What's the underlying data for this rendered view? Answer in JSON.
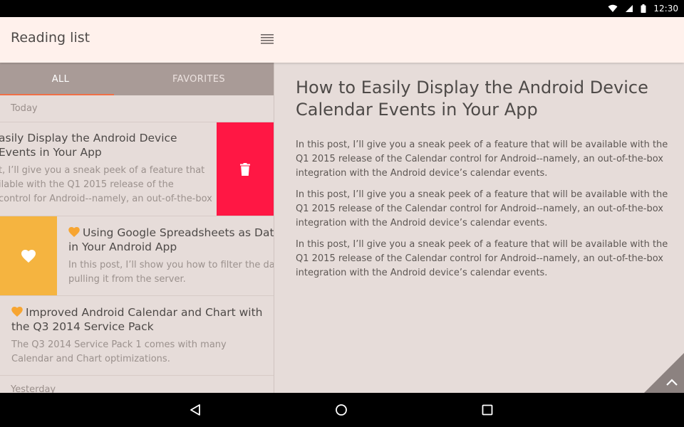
{
  "status_bar": {
    "time": "12:30",
    "icons": [
      "wifi-icon",
      "signal-icon",
      "battery-icon"
    ]
  },
  "app_bar": {
    "title": "Reading list",
    "menu_icon": "list-icon"
  },
  "tabs": [
    {
      "label": "ALL",
      "selected": true
    },
    {
      "label": "FAVORITES",
      "selected": false
    }
  ],
  "list": {
    "section_today": "Today",
    "section_yesterday": "Yesterday",
    "items": [
      {
        "title_line1": "asily Display the Android Device",
        "title_line2": " Events in Your App",
        "body_line1": "t, I’ll give you a sneak peek of a feature that",
        "body_line2": "ilable with the Q1 2015 release of the",
        "body_line3": "control for Android--namely, an out-of-the-box",
        "favorite": false,
        "swipe_action": "delete",
        "swipe_icon": "trash-icon"
      },
      {
        "title_line1": "Using Google Spreadsheets as Data S",
        "title_line2": "in Your Android App",
        "body_line1": "In this post, I’ll show you how to filter the data",
        "body_line2": "pulling it from the server.",
        "favorite": true,
        "swipe_action": "favorite",
        "swipe_icon": "heart-icon"
      },
      {
        "title_line1": "Improved Android Calendar and Chart with",
        "title_line2": "the Q3 2014 Service Pack",
        "body_line1": "The Q3 2014 Service Pack 1 comes with many",
        "body_line2": "Calendar and Chart optimizations.",
        "favorite": true
      }
    ]
  },
  "detail": {
    "title": "How to Easily Display the Android Device Calendar Events in Your App",
    "paragraphs": [
      "In this post, I’ll give you a sneak peek of a feature that will be available with the Q1 2015 release of the Calendar control for Android--namely, an out-of-the-box integration with the Android device’s calendar events.",
      "In this post, I’ll give you a sneak peek of a feature that will be available with the Q1 2015 release of the Calendar control for Android--namely, an out-of-the-box integration with the Android device’s calendar events.",
      "In this post, I’ll give you a sneak peek of a feature that will be available with the Q1 2015 release of the Calendar control for Android--namely, an out-of-the-box integration with the Android device’s calendar events."
    ],
    "scroll_top_icon": "chevron-up-icon"
  },
  "nav_bar": {
    "buttons": [
      "back-icon",
      "home-icon",
      "recents-icon"
    ]
  },
  "colors": {
    "app_bar_bg": "#fff1ec",
    "tab_bg": "#a99b97",
    "tab_indicator": "#ef6f47",
    "delete_red": "#ff1744",
    "favorite_orange": "#f5b440",
    "heart_accent": "#f7a531",
    "content_bg": "#e6dcd9",
    "fab_grey": "#8c8280"
  }
}
